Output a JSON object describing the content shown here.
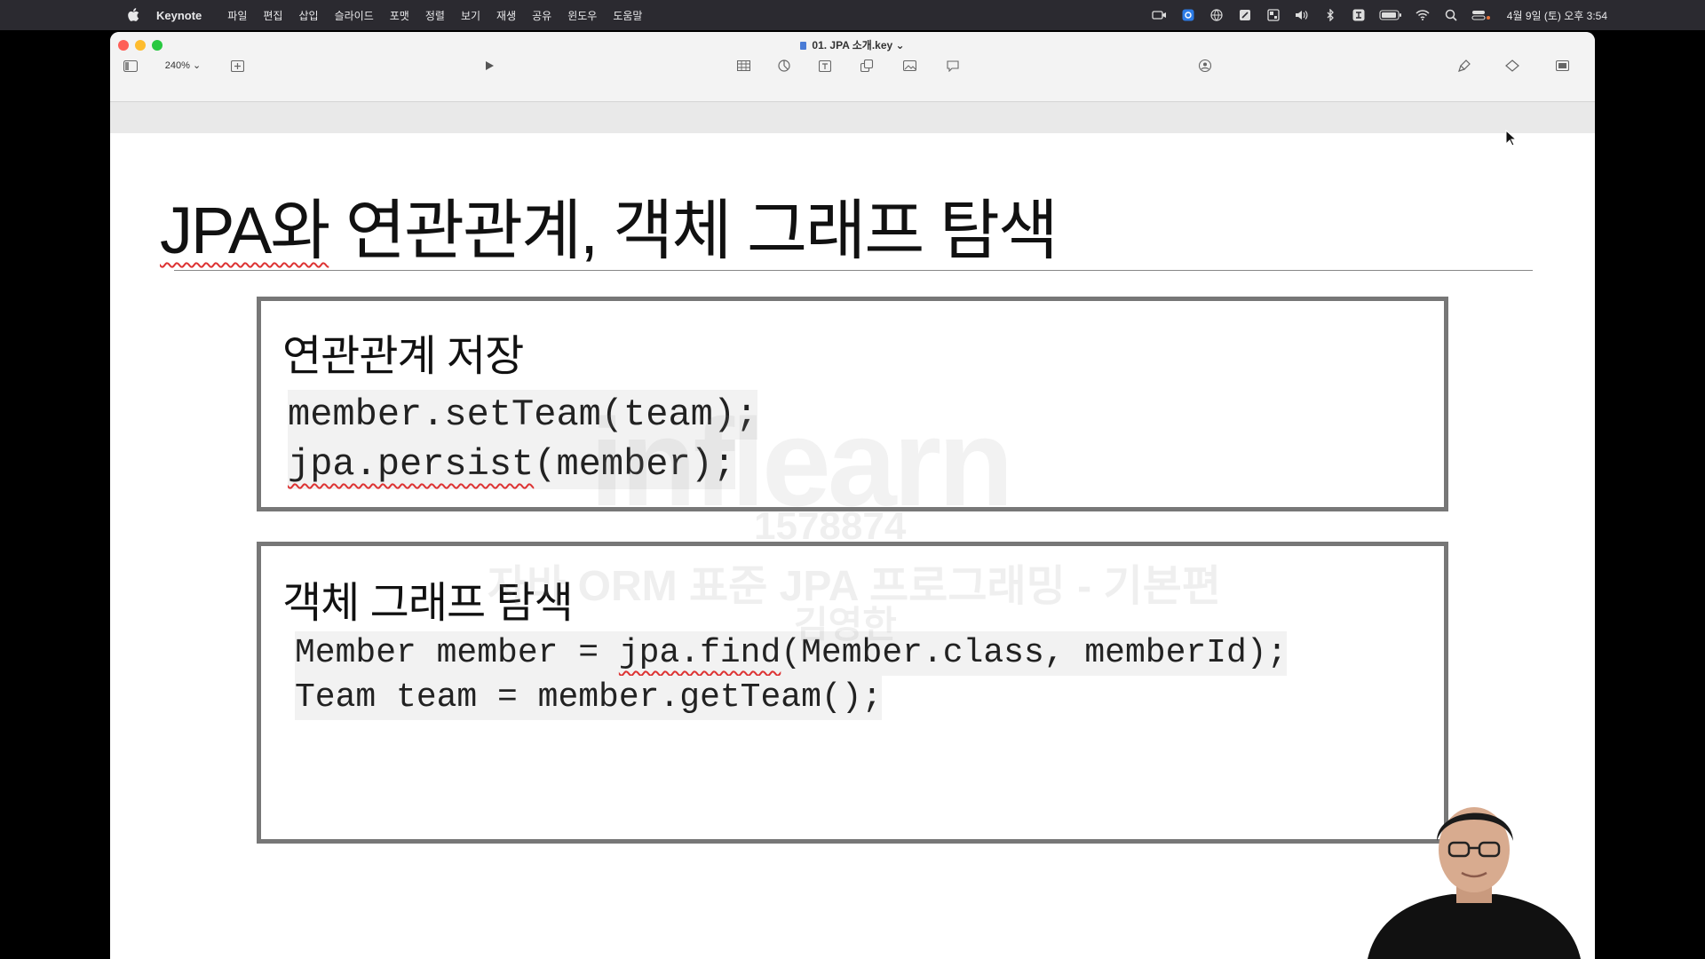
{
  "menubar": {
    "app_name": "Keynote",
    "items": [
      "파일",
      "편집",
      "삽입",
      "슬라이드",
      "포맷",
      "정렬",
      "보기",
      "재생",
      "공유",
      "윈도우",
      "도움말"
    ],
    "clock": "4월 9일 (토) 오후 3:54"
  },
  "window": {
    "document_title": "01. JPA 소개.key ⌄",
    "zoom": "240% ⌄"
  },
  "slide": {
    "title_highlight": "JPA와",
    "title_rest": " 연관관계, 객체 그래프 탐색",
    "box1": {
      "heading": "연관관계 저장",
      "line1": "member.setTeam(team);",
      "line2_highlight": "jpa.persist",
      "line2_rest": "(member);"
    },
    "box2": {
      "heading": "객체 그래프 탐색",
      "line1_prefix": "Member member = ",
      "line1_highlight": "jpa.find",
      "line1_rest": "(Member.class, memberId);",
      "line2": "Team team = member.getTeam();"
    }
  },
  "watermark": {
    "logo": "inflearn",
    "id": "1578874",
    "course": "자바 ORM 표준 JPA 프로그래밍 - 기본편",
    "author": "김영한"
  },
  "colors": {
    "menubar_bg": "#2b2a30",
    "spellcheck": "#dd3333",
    "box_border": "#777777"
  }
}
